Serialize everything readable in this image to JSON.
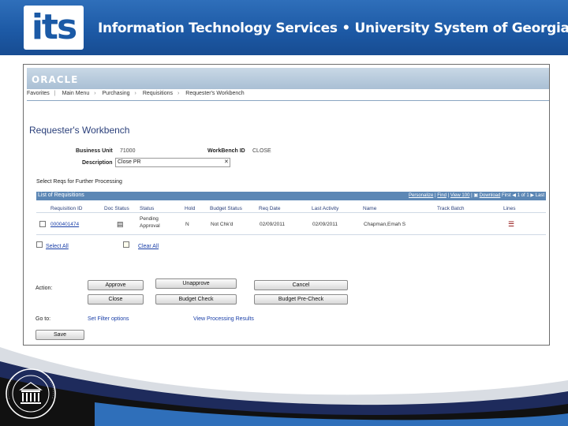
{
  "banner": {
    "logo_text": "its",
    "title": "Information Technology Services  •  University System of Georgia"
  },
  "seal": {
    "text": "BOARD OF REGENTS OF THE UNIVERSITY SYSTEM OF GEORGIA"
  },
  "app": {
    "brand": "ORACLE",
    "breadcrumb": [
      "Favorites",
      "Main Menu",
      "Purchasing",
      "Requisitions",
      "Requester's Workbench"
    ]
  },
  "page": {
    "title": "Requester's Workbench",
    "business_unit_label": "Business Unit",
    "business_unit_value": "71000",
    "workbench_id_label": "WorkBench ID",
    "workbench_id_value": "CLOSE",
    "description_label": "Description",
    "description_value": "Close PR",
    "section_label": "Select Reqs for Further Processing"
  },
  "grid": {
    "title": "List of Requisitions",
    "tools": [
      "Personalize",
      "Find",
      "View 100"
    ],
    "download_label": "Download",
    "pager_first": "First",
    "pager_range": "1 of 1",
    "pager_last": "Last",
    "columns": [
      "Requisition ID",
      "Doc Status",
      "Status",
      "Hold",
      "Budget Status",
      "Req Date",
      "Last Activity",
      "Name",
      "Track Batch",
      "Lines"
    ],
    "rows": [
      {
        "requisition_id": "0000401474",
        "status_line1": "Pending",
        "status_line2": "Approval",
        "hold": "N",
        "budget_status": "Not Chk'd",
        "req_date": "02/09/2011",
        "last_activity": "02/09/2011",
        "name": "Chapman,Emah S"
      }
    ]
  },
  "select_all": "Select All",
  "clear_all": "Clear All",
  "action": {
    "label": "Action:",
    "buttons": [
      "Approve",
      "Unapprove",
      "Cancel",
      "Close",
      "Budget Check",
      "Budget Pre-Check"
    ]
  },
  "goto": {
    "label": "Go to:",
    "links": [
      "Set Filter options",
      "View Processing Results"
    ]
  },
  "save_label": "Save"
}
